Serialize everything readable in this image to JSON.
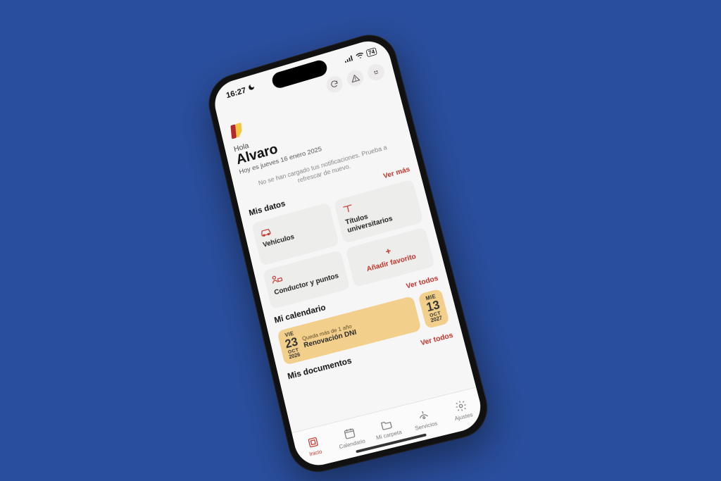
{
  "status": {
    "time": "16:27",
    "battery": "74"
  },
  "icons": {
    "moon": "moon-icon",
    "signal": "signal-icon",
    "wifi": "wifi-icon"
  },
  "header": {
    "refresh": "refresh",
    "warning": "warning",
    "profile": "profile"
  },
  "greeting": {
    "hello": "Hola",
    "name": "Alvaro",
    "date": "Hoy es jueves 16 enero 2025"
  },
  "notice": "No se han cargado tus notificaciones. Prueba a refrescar de nuevo.",
  "links": {
    "see_more": "Ver más",
    "see_all": "Ver todos"
  },
  "sections": {
    "my_data": "Mis datos",
    "my_calendar": "Mi calendario",
    "my_documents": "Mis documentos"
  },
  "tiles": {
    "degrees": "Títulos universitarios",
    "vehicles": "Vehículos",
    "driver": "Conductor y puntos",
    "add": "Añadir favorito",
    "plus": "+"
  },
  "calendar": {
    "item1": {
      "dow": "VIE",
      "day": "23",
      "month": "OCT",
      "year": "2026",
      "sub": "Queda más de 1 año",
      "title": "Renovación DNI"
    },
    "item2": {
      "dow": "MIE",
      "day": "13",
      "month": "OCT",
      "year": "2027"
    }
  },
  "tabs": {
    "home": "Inicio",
    "calendar": "Calendario",
    "folder": "Mi carpeta",
    "services": "Servicios",
    "settings": "Ajustes"
  }
}
